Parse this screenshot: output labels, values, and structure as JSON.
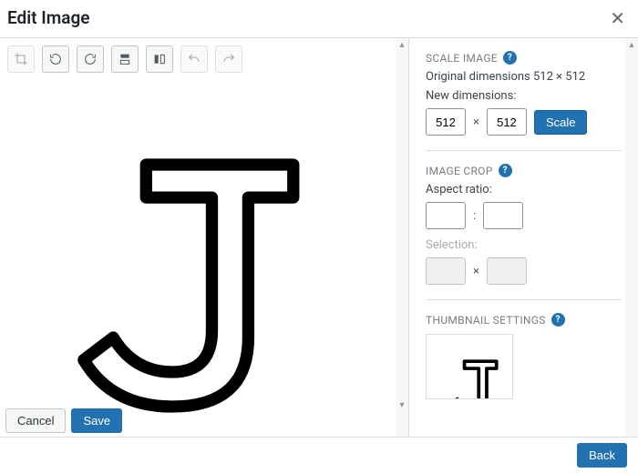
{
  "dialog": {
    "title": "Edit Image"
  },
  "toolbar": {},
  "actions": {
    "cancel": "Cancel",
    "save": "Save",
    "back": "Back"
  },
  "scale": {
    "heading": "SCALE IMAGE",
    "original_label": "Original dimensions 512 × 512",
    "newdim_label": "New dimensions:",
    "width": "512",
    "height": "512",
    "button": "Scale"
  },
  "crop": {
    "heading": "IMAGE CROP",
    "aspect_label": "Aspect ratio:",
    "aspect_w": "",
    "aspect_h": "",
    "selection_label": "Selection:",
    "sel_w": "",
    "sel_h": ""
  },
  "thumb": {
    "heading": "THUMBNAIL SETTINGS"
  }
}
